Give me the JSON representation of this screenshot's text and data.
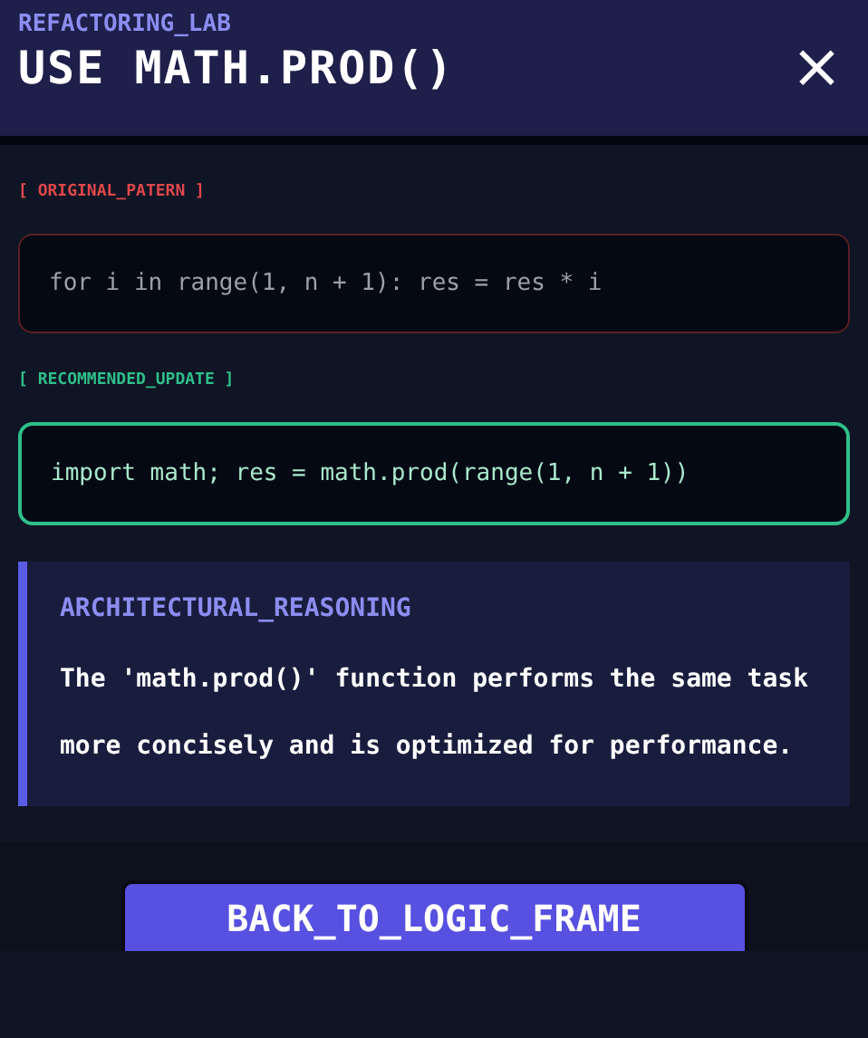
{
  "header": {
    "subtitle": "REFACTORING_LAB",
    "title": "USE MATH.PROD()",
    "close": "×"
  },
  "snippets": [
    {
      "kind": "original",
      "label": "[ ORIGINAL_PATERN ]",
      "code": "for i in range(1, n + 1): res = res * i"
    },
    {
      "kind": "recommended",
      "label": "[ RECOMMENDED_UPDATE ]",
      "code": "import math; res = math.prod(range(1, n + 1))"
    }
  ],
  "reasoning": {
    "title": "ARCHITECTURAL_REASONING",
    "text": "The 'math.prod()' function performs the same task more concisely and is optimized for performance."
  },
  "footer": {
    "button": "BACK_TO_LOGIC_FRAME"
  }
}
